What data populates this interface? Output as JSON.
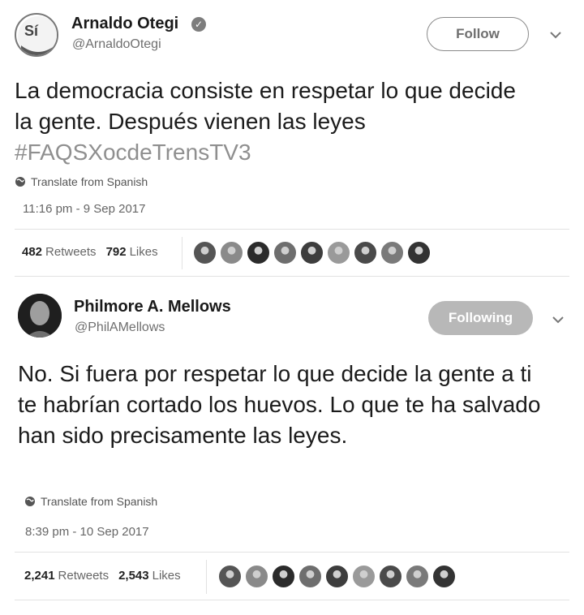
{
  "tweets": [
    {
      "author": {
        "name": "Arnaldo Otegi",
        "handle": "@ArnaldoOtegi",
        "avatar_text": "Sí",
        "verified": true
      },
      "button_label": "Follow",
      "text": "La democracia consiste en respetar lo que decide la gente. Después vienen las leyes",
      "hashtag": "#FAQSXocdeTrensTV3",
      "translate_label": "Translate from Spanish",
      "timestamp": "11:16 pm - 9 Sep 2017",
      "retweets": {
        "count": "482",
        "label": "Retweets"
      },
      "likes": {
        "count": "792",
        "label": "Likes"
      },
      "liker_avatars": [
        "liker-avatar",
        "liker-avatar",
        "liker-avatar",
        "liker-avatar",
        "liker-avatar",
        "liker-avatar",
        "liker-avatar",
        "liker-avatar",
        "liker-avatar"
      ]
    },
    {
      "author": {
        "name": "Philmore A. Mellows",
        "handle": "@PhilAMellows",
        "verified": false
      },
      "button_label": "Following",
      "text": "No. Si fuera por respetar lo que decide la gente a ti te habrían cortado los huevos. Lo que te ha salvado han sido precisamente las leyes.",
      "translate_label": "Translate from Spanish",
      "timestamp": "8:39 pm - 10 Sep 2017",
      "retweets": {
        "count": "2,241",
        "label": "Retweets"
      },
      "likes": {
        "count": "2,543",
        "label": "Likes"
      },
      "liker_avatars": [
        "liker-avatar",
        "liker-avatar",
        "liker-avatar",
        "liker-avatar",
        "liker-avatar",
        "liker-avatar",
        "liker-avatar",
        "liker-avatar",
        "liker-avatar"
      ]
    }
  ],
  "colors": {
    "muted": "#6f6f6f",
    "hashtag": "#8f8f8f",
    "following_bg": "#b8b8b8"
  }
}
